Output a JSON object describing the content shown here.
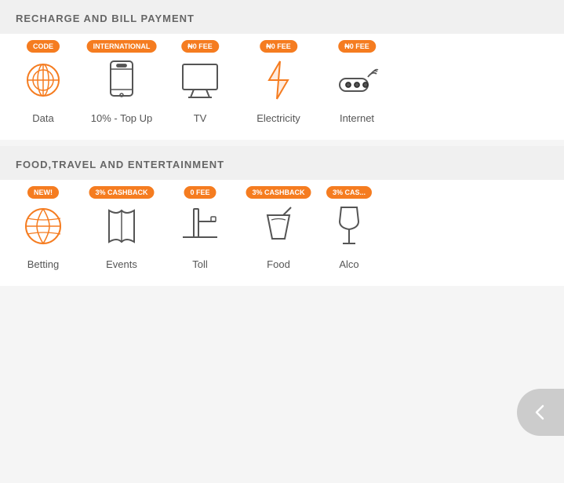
{
  "sections": [
    {
      "id": "recharge",
      "header": "RECHARGE AND BILL PAYMENT",
      "items": [
        {
          "id": "code",
          "badge": "CODE",
          "label": "Data",
          "icon": "data"
        },
        {
          "id": "international",
          "badge": "INTERNATIONAL",
          "label": "10% - Top Up",
          "icon": "phone"
        },
        {
          "id": "tv",
          "badge": "₦0 FEE",
          "label": "TV",
          "icon": "tv"
        },
        {
          "id": "electricity",
          "badge": "₦0 FEE",
          "label": "Electricity",
          "icon": "electricity"
        },
        {
          "id": "internet",
          "badge": "₦0 FEE",
          "label": "Internet",
          "icon": "internet"
        }
      ]
    },
    {
      "id": "food-travel",
      "header": "FOOD,TRAVEL AND ENTERTAINMENT",
      "items": [
        {
          "id": "betting",
          "badge": "NEW!",
          "label": "Betting",
          "icon": "soccer"
        },
        {
          "id": "events",
          "badge": "3% CASHBACK",
          "label": "Events",
          "icon": "events"
        },
        {
          "id": "toll",
          "badge": "0 FEE",
          "label": "Toll",
          "icon": "toll"
        },
        {
          "id": "food",
          "badge": "3% CASHBACK",
          "label": "Food",
          "icon": "food"
        },
        {
          "id": "alco",
          "badge": "3% CAS...",
          "label": "Alco",
          "icon": "alcohol"
        }
      ]
    }
  ],
  "back_button": "←"
}
